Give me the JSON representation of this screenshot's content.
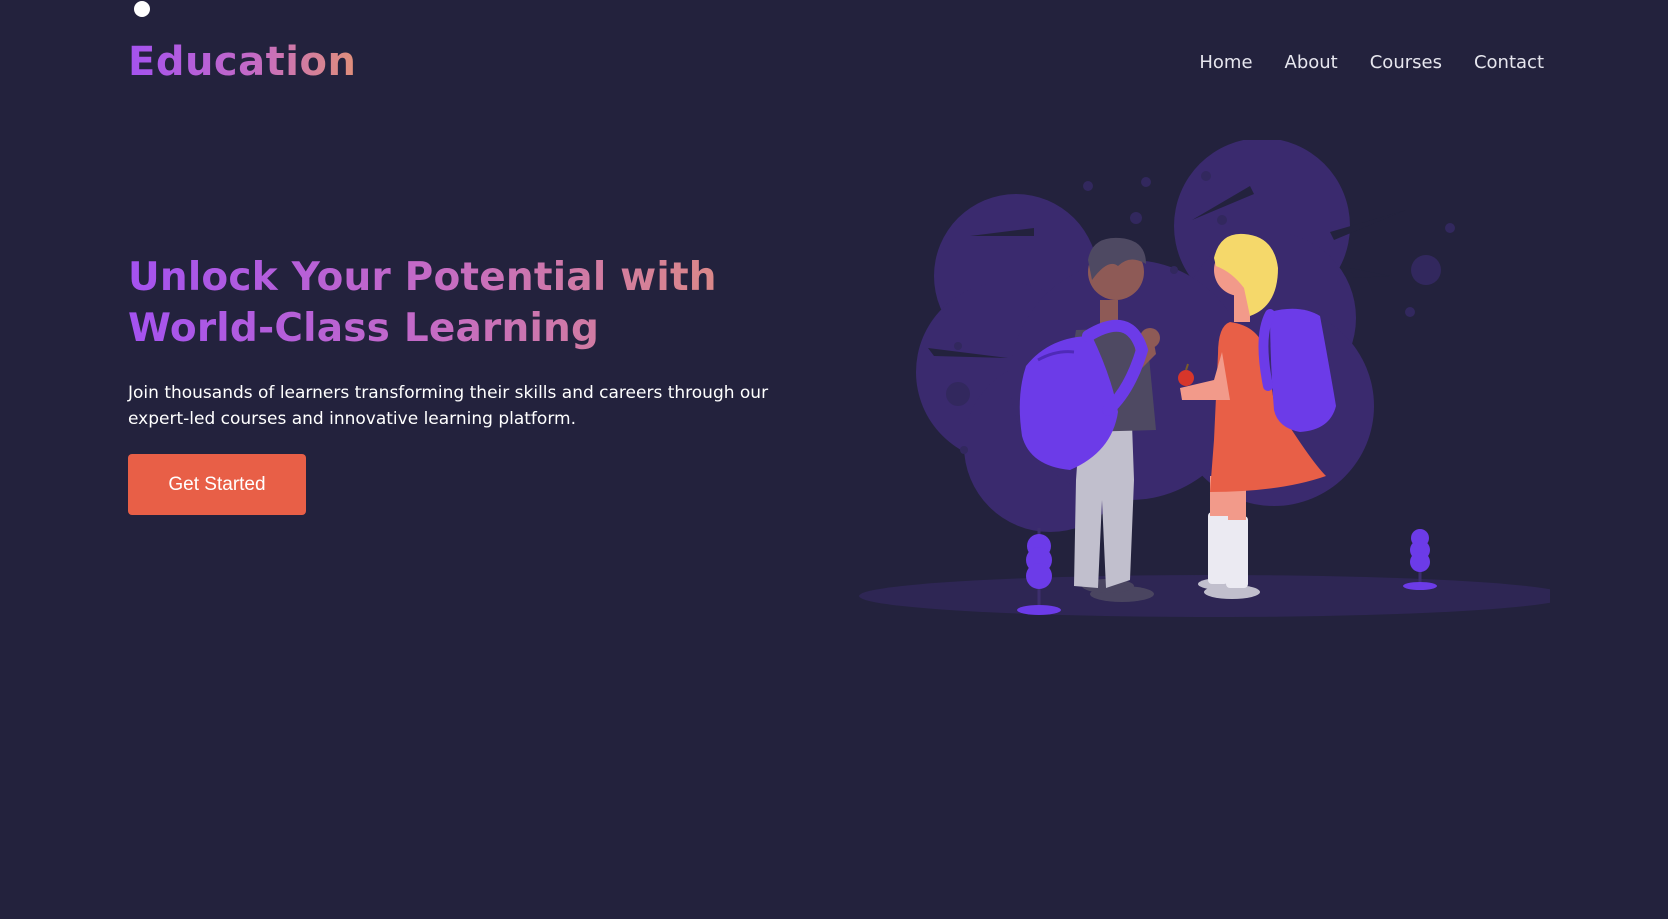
{
  "brand": {
    "logo_text": "Education"
  },
  "nav": {
    "items": [
      {
        "label": "Home"
      },
      {
        "label": "About"
      },
      {
        "label": "Courses"
      },
      {
        "label": "Contact"
      }
    ]
  },
  "hero": {
    "title_line1": "Unlock Your Potential with",
    "title_line2": "World-Class Learning",
    "subtitle": "Join thousands of learners transforming their skills and careers through our expert-led courses and innovative learning platform.",
    "cta_label": "Get Started"
  },
  "illustration": {
    "icon": "students-with-backpacks-illustration"
  },
  "colors": {
    "background": "#23223d",
    "gradient_start": "#a452f0",
    "gradient_end": "#e08f7a",
    "cta": "#e85f47",
    "accent_purple": "#6c3be8",
    "blob_purple": "#3a2a6e"
  }
}
